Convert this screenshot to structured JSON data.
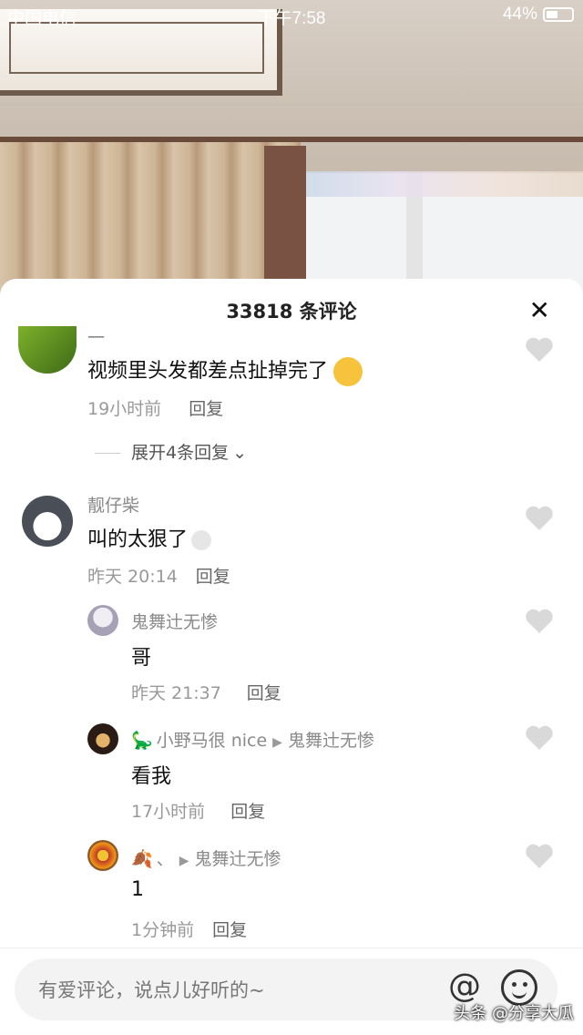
{
  "status_bar": {
    "carrier": "中国电信",
    "time": "下午7:58",
    "battery": "44%"
  },
  "sheet": {
    "title": "33818 条评论"
  },
  "comments": [
    {
      "name": "一",
      "text": "视频里头发都差点扯掉完了",
      "time": "19小时前",
      "reply": "回复",
      "expand": "展开4条回复"
    },
    {
      "name": "靓仔柴",
      "text": "叫的太狠了",
      "time": "昨天 20:14",
      "reply": "回复"
    },
    {
      "name": "鬼舞辻无惨",
      "text": "哥",
      "time": "昨天 21:37",
      "reply": "回复"
    },
    {
      "name": "小野马很 nice",
      "reply_to": "鬼舞辻无惨",
      "text": "看我",
      "time": "17小时前",
      "reply": "回复"
    },
    {
      "name": "、",
      "reply_to": "鬼舞辻无惨",
      "text": "1",
      "time": "1分钟前",
      "reply": "回复"
    }
  ],
  "input": {
    "placeholder": "有爱评论，说点儿好听的~"
  },
  "watermark": "头条 @分享大瓜",
  "colors": {
    "sheet_bg": "#ffffff",
    "input_bg": "#f3f3f3",
    "meta": "#999999"
  }
}
